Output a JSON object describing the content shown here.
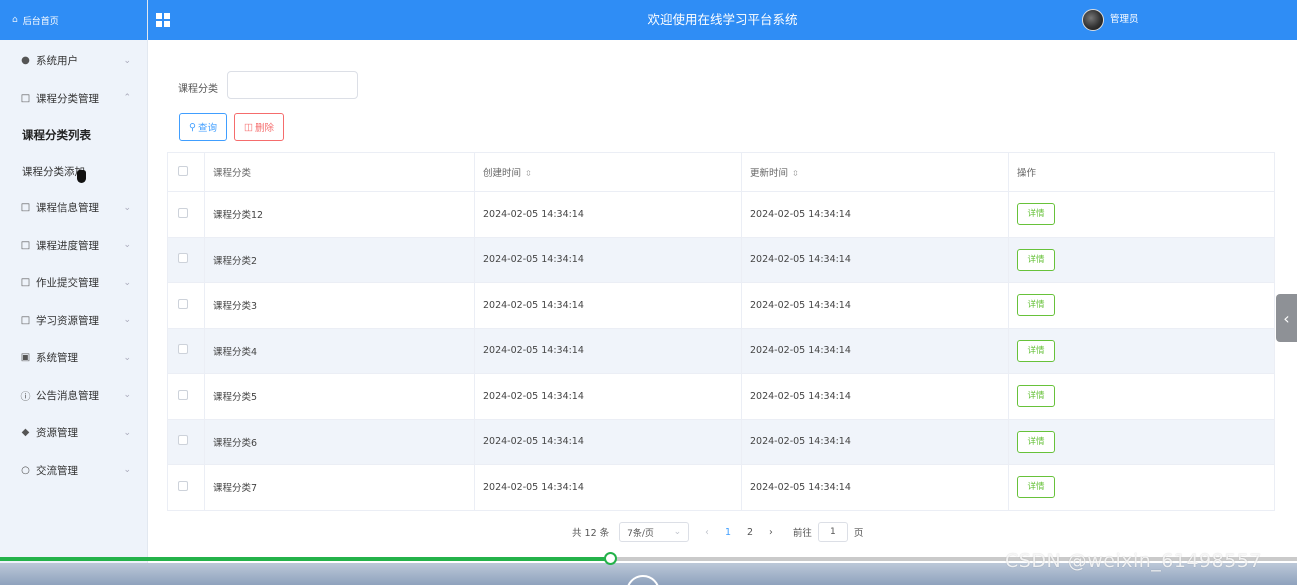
{
  "sidebar": {
    "home": "后台首页",
    "items": [
      {
        "label": "系统用户",
        "icon": "user-icon"
      },
      {
        "label": "课程分类管理",
        "icon": "folder-icon",
        "expanded": true
      },
      {
        "label": "课程信息管理",
        "icon": "folder-icon"
      },
      {
        "label": "课程进度管理",
        "icon": "folder-icon"
      },
      {
        "label": "作业提交管理",
        "icon": "folder-icon"
      },
      {
        "label": "学习资源管理",
        "icon": "folder-icon"
      },
      {
        "label": "系统管理",
        "icon": "image-icon"
      },
      {
        "label": "公告消息管理",
        "icon": "info-icon"
      },
      {
        "label": "资源管理",
        "icon": "location-icon"
      },
      {
        "label": "交流管理",
        "icon": "chat-icon"
      }
    ],
    "subitems": [
      {
        "label": "课程分类列表",
        "active": true
      },
      {
        "label": "课程分类添加",
        "active": false
      }
    ]
  },
  "header": {
    "title": "欢迎使用在线学习平台系统",
    "user": "管理员"
  },
  "filter": {
    "label": "课程分类",
    "value": "",
    "search_label": "查询",
    "delete_label": "删除"
  },
  "table": {
    "headers": [
      "课程分类",
      "创建时间",
      "更新时间",
      "操作"
    ],
    "rows": [
      {
        "name": "课程分类12",
        "created": "2024-02-05 14:34:14",
        "updated": "2024-02-05 14:34:14",
        "action": "详情"
      },
      {
        "name": "课程分类2",
        "created": "2024-02-05 14:34:14",
        "updated": "2024-02-05 14:34:14",
        "action": "详情"
      },
      {
        "name": "课程分类3",
        "created": "2024-02-05 14:34:14",
        "updated": "2024-02-05 14:34:14",
        "action": "详情"
      },
      {
        "name": "课程分类4",
        "created": "2024-02-05 14:34:14",
        "updated": "2024-02-05 14:34:14",
        "action": "详情"
      },
      {
        "name": "课程分类5",
        "created": "2024-02-05 14:34:14",
        "updated": "2024-02-05 14:34:14",
        "action": "详情"
      },
      {
        "name": "课程分类6",
        "created": "2024-02-05 14:34:14",
        "updated": "2024-02-05 14:34:14",
        "action": "详情"
      },
      {
        "name": "课程分类7",
        "created": "2024-02-05 14:34:14",
        "updated": "2024-02-05 14:34:14",
        "action": "详情"
      }
    ]
  },
  "pagination": {
    "total": "共 12 条",
    "page_size": "7条/页",
    "pages": [
      "1",
      "2"
    ],
    "current_page": "1",
    "goto_label": "前往",
    "goto_value": "1",
    "page_suffix": "页"
  },
  "video": {
    "progress": 0.47
  },
  "watermark": "CSDN @weixin_61498557",
  "colors": {
    "primary": "#2f8df5",
    "danger": "#f56c6c",
    "success": "#67c23a",
    "progress": "#24b24a"
  }
}
